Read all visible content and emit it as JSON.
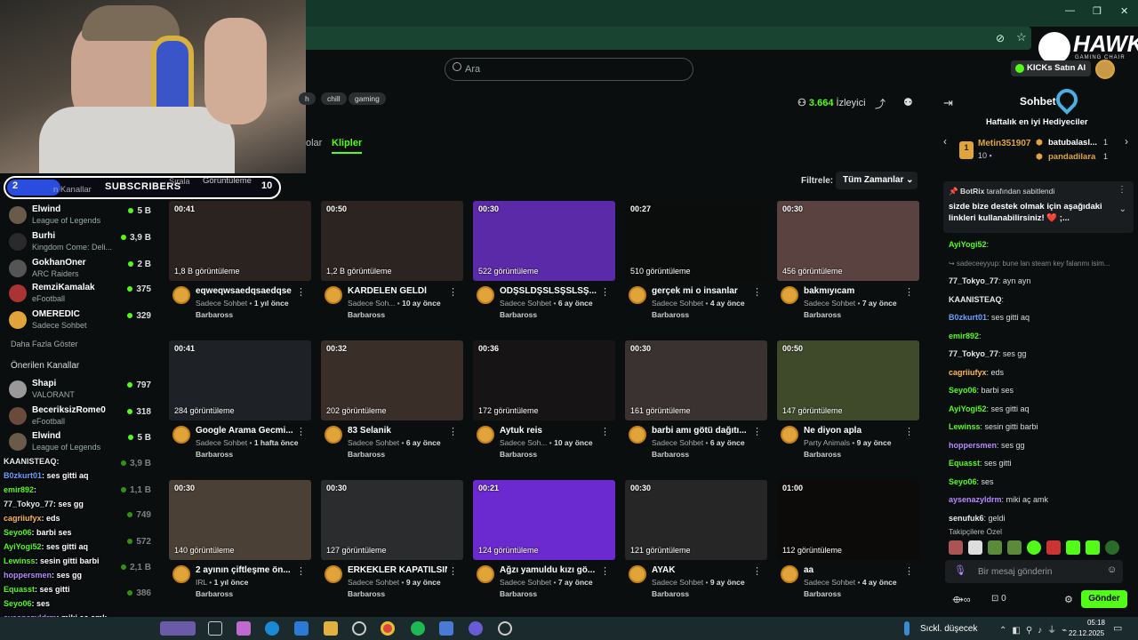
{
  "window": {
    "minimize": "—",
    "restore": "❐",
    "close": "✕"
  },
  "search": {
    "placeholder": "Ara"
  },
  "header": {
    "brand_line1": "HAWK",
    "brand_line2": "GAMING CHAIR",
    "buy_kicks": "KICKs Satın Al",
    "viewers": "3.664",
    "viewers_label": "İzleyici"
  },
  "tags": [
    "h",
    "chill",
    "gaming"
  ],
  "tabs": {
    "videolar": "olar",
    "klipler": "Klipler"
  },
  "filter": {
    "sort_label": "Sırala",
    "sort_value": "Görüntüleme",
    "label": "Filtrele:",
    "value": "Tüm Zamanlar"
  },
  "subs_widget": {
    "count": "2",
    "label": "SUBSCRIBERS",
    "goal": "10",
    "left_text": "n Kanallar"
  },
  "sidebar": {
    "followed": [
      {
        "name": "Elwind",
        "game": "League of Legends",
        "viewers": "5 B"
      },
      {
        "name": "Burhi",
        "game": "Kingdom Come: Deli...",
        "viewers": "3,9 B"
      },
      {
        "name": "GokhanOner",
        "game": "ARC Raiders",
        "viewers": "2 B"
      },
      {
        "name": "RemziKamalak",
        "game": "eFootball",
        "viewers": "375"
      },
      {
        "name": "OMEREDIC",
        "game": "Sadece Sohbet",
        "viewers": "329"
      }
    ],
    "show_more": "Daha Fazla Göster",
    "recommended_title": "Önerilen Kanallar",
    "recommended": [
      {
        "name": "Shapi",
        "game": "VALORANT",
        "viewers": "797"
      },
      {
        "name": "BeceriksizRome0",
        "game": "eFootball",
        "viewers": "318"
      },
      {
        "name": "Elwind",
        "game": "League of Legends",
        "viewers": "5 B"
      }
    ],
    "faded": [
      {
        "viewers": "3,9 B"
      },
      {
        "viewers": "1,1 B"
      },
      {
        "viewers": "749"
      },
      {
        "viewers": "572"
      },
      {
        "viewers": "2,1 B"
      },
      {
        "viewers": "386"
      }
    ]
  },
  "overlay_chat": [
    {
      "user": "KAANISTEAQ",
      "text": ":",
      "color": "#e8eaea"
    },
    {
      "user": "B0zkurt01",
      "text": ": ses gitti aq",
      "color": "#6aa0ff"
    },
    {
      "user": "emir892",
      "text": ":",
      "color": "#53fc18"
    },
    {
      "user": "77_Tokyo_77",
      "text": ": ses gg",
      "color": "#e8eaea"
    },
    {
      "user": "cagriiufyx",
      "text": ": eds",
      "color": "#ffb84d"
    },
    {
      "user": "Seyo06",
      "text": ": barbi ses",
      "color": "#53fc18"
    },
    {
      "user": "AyiYogi52",
      "text": ": ses gitti aq",
      "color": "#53fc18"
    },
    {
      "user": "Lewinss",
      "text": ": sesin gitti barbi",
      "color": "#53fc18"
    },
    {
      "user": "hoppersmen",
      "text": ": ses gg",
      "color": "#b48aff"
    },
    {
      "user": "Equasst",
      "text": ": ses gitti",
      "color": "#53fc18"
    },
    {
      "user": "Seyo06",
      "text": ": ses",
      "color": "#53fc18"
    },
    {
      "user": "aysenazyldrm",
      "text": ": miki aç amk",
      "color": "#b48aff"
    },
    {
      "user": "senufuk6",
      "text": ": geldi",
      "color": "#e8eaea"
    }
  ],
  "clips": [
    {
      "dur": "00:41",
      "views": "1,8 B görüntüleme",
      "title": "eqweqwsaedqsaedqse",
      "cat": "Sadece Sohbet",
      "age": "1 yıl önce",
      "ch": "Barbaross",
      "bg": "#2a2320"
    },
    {
      "dur": "00:50",
      "views": "1,2 B görüntüleme",
      "title": "KARDELEN GELDİ",
      "cat": "Sadece Soh...",
      "age": "10 ay önce",
      "ch": "Barbaross",
      "bg": "#2c2420"
    },
    {
      "dur": "00:30",
      "views": "522 görüntüleme",
      "title": "ÖDŞSLDŞSLSŞSLSŞ...",
      "cat": "Sadece Sohbet",
      "age": "6 ay önce",
      "ch": "Barbaross",
      "bg": "#5a2aa8"
    },
    {
      "dur": "00:27",
      "views": "510 görüntüleme",
      "title": "gerçek mi o insanlar",
      "cat": "Sadece Sohbet",
      "age": "4 ay önce",
      "ch": "Barbaross",
      "bg": "#0a0d0c"
    },
    {
      "dur": "00:30",
      "views": "456 görüntüleme",
      "title": "bakmıyıcam",
      "cat": "Sadece Sohbet",
      "age": "7 ay önce",
      "ch": "Barbaross",
      "bg": "#5a4240"
    },
    {
      "dur": "00:41",
      "views": "284 görüntüleme",
      "title": "Google Arama Gecmi...",
      "cat": "Sadece Sohbet",
      "age": "1 hafta önce",
      "ch": "Barbaross",
      "bg": "#1e2226"
    },
    {
      "dur": "00:32",
      "views": "202 görüntüleme",
      "title": "83 Selanik",
      "cat": "Sadece Sohbet",
      "age": "6 ay önce",
      "ch": "Barbaross",
      "bg": "#3a2e28"
    },
    {
      "dur": "00:36",
      "views": "172 görüntüleme",
      "title": "Aytuk reis",
      "cat": "Sadece Soh...",
      "age": "10 ay önce",
      "ch": "Barbaross",
      "bg": "#161414"
    },
    {
      "dur": "00:30",
      "views": "161 görüntüleme",
      "title": "barbi amı götü dağıtı...",
      "cat": "Sadece Sohbet",
      "age": "6 ay önce",
      "ch": "Barbaross",
      "bg": "#3a3230"
    },
    {
      "dur": "00:50",
      "views": "147 görüntüleme",
      "title": "Ne diyon apla",
      "cat": "Party Animals",
      "age": "9 ay önce",
      "ch": "Barbaross",
      "bg": "#3e4a2a"
    },
    {
      "dur": "00:30",
      "views": "140 görüntüleme",
      "title": "2 ayının çiftleşme ön...",
      "cat": "IRL",
      "age": "1 yıl önce",
      "ch": "Barbaross",
      "bg": "#4a4036"
    },
    {
      "dur": "00:30",
      "views": "127 görüntüleme",
      "title": "ERKEKLER KAPATILSIN",
      "cat": "Sadece Sohbet",
      "age": "9 ay önce",
      "ch": "Barbaross",
      "bg": "#2a2c2e"
    },
    {
      "dur": "00:21",
      "views": "124 görüntüleme",
      "title": "Ağzı yamuldu kızı gö...",
      "cat": "Sadece Sohbet",
      "age": "7 ay önce",
      "ch": "Barbaross",
      "bg": "#6a2ad0"
    },
    {
      "dur": "00:30",
      "views": "121 görüntüleme",
      "title": "AYAK",
      "cat": "Sadece Sohbet",
      "age": "9 ay önce",
      "ch": "Barbaross",
      "bg": "#262626"
    },
    {
      "dur": "01:00",
      "views": "112 görüntüleme",
      "title": "aa",
      "cat": "Sadece Sohbet",
      "age": "4 ay önce",
      "ch": "Barbaross",
      "bg": "#0c0b0a"
    }
  ],
  "chat": {
    "title": "Sohbet",
    "gifters_title": "Haftalık en iyi Hediyeciler",
    "gifters": [
      {
        "rank": "1",
        "name": "Metin351907",
        "amount": "10"
      },
      {
        "name": "batubalasl...",
        "amount": "1"
      },
      {
        "name": "pandadilara",
        "amount": "1"
      }
    ],
    "pinned_user": "BotRix",
    "pinned_suffix": "tarafından sabitlendi",
    "pinned_text": "sizde bize destek olmak için aşağıdaki linkleri kullanabilirsiniz! ❤️ ;...",
    "messages": [
      {
        "user": "AyiYogi52",
        "text": ":",
        "color": "#53fc18"
      },
      {
        "user": "",
        "text": "↪ sadeceeyyup: bune lan steam key falanmı isim...",
        "color": "#888"
      },
      {
        "user": "77_Tokyo_77",
        "text": ": ayn ayn",
        "color": "#e8eaea"
      },
      {
        "user": "KAANISTEAQ",
        "text": ":",
        "color": "#e8eaea"
      },
      {
        "user": "B0zkurt01",
        "text": ": ses gitti aq",
        "color": "#6aa0ff"
      },
      {
        "user": "emir892",
        "text": ":",
        "color": "#53fc18"
      },
      {
        "user": "77_Tokyo_77",
        "text": ": ses gg",
        "color": "#e8eaea"
      },
      {
        "user": "cagriiufyx",
        "text": ": eds",
        "color": "#ffb84d"
      },
      {
        "user": "Seyo06",
        "text": ": barbi ses",
        "color": "#53fc18"
      },
      {
        "user": "AyiYogi52",
        "text": ": ses gitti aq",
        "color": "#53fc18"
      },
      {
        "user": "Lewinss",
        "text": ": sesin gitti barbi",
        "color": "#53fc18"
      },
      {
        "user": "hoppersmen",
        "text": ": ses gg",
        "color": "#b48aff"
      },
      {
        "user": "Equasst",
        "text": ": ses gitti",
        "color": "#53fc18"
      },
      {
        "user": "Seyo06",
        "text": ": ses",
        "color": "#53fc18"
      },
      {
        "user": "aysenazyldrm",
        "text": ": miki aç amk",
        "color": "#b48aff"
      },
      {
        "user": "senufuk6",
        "text": ": geldi",
        "color": "#e8eaea"
      }
    ],
    "followers_special": "Takipçilere Özel",
    "input_placeholder": "Bir mesaj gönderin",
    "points": "0",
    "send": "Gönder"
  },
  "taskbar": {
    "weather": "Sıckl. düşecek",
    "time": "05:18",
    "date": "22.12.2025"
  },
  "colors": {
    "accent": "#53fc18",
    "bg": "#0b0e0f",
    "titlebar": "#14382a"
  }
}
